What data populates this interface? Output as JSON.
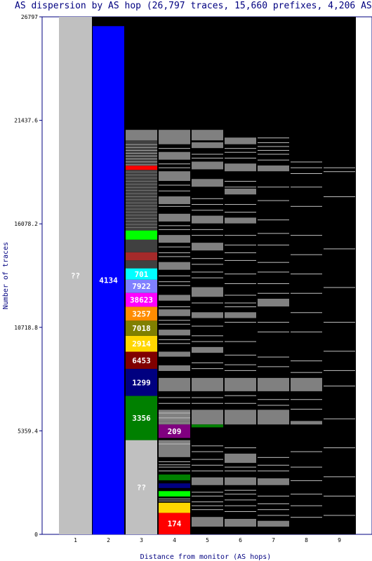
{
  "chart_data": {
    "type": "bar",
    "title": "AS dispersion by AS hop (26,797 traces, 15,660 prefixes, 4,206 ASes)",
    "xlabel": "Distance from monitor (AS hops)",
    "ylabel": "Number of traces",
    "ylim": [
      0,
      26797
    ],
    "y_ticks": [
      "0",
      "5359.4",
      "10718.8",
      "16078.2",
      "21437.6",
      "26797"
    ],
    "categories": [
      "1",
      "2",
      "3",
      "4",
      "5",
      "6",
      "7",
      "8",
      "9"
    ],
    "background_color": "#000000",
    "minor_segment_color": "#808080",
    "minor_line_color": "#c0c0c0",
    "labeled_segments": [
      {
        "hop": "1",
        "label": "??",
        "from": 0,
        "to": 26797,
        "color": "#c0c0c0"
      },
      {
        "hop": "2",
        "label": "4134",
        "from": 0,
        "to": 26315,
        "color": "#0000ff"
      },
      {
        "hop": "3",
        "label": "??",
        "from": 0,
        "to": 4880,
        "color": "#c0c0c0"
      },
      {
        "hop": "3",
        "label": "3356",
        "from": 4880,
        "to": 7169,
        "color": "#008000"
      },
      {
        "hop": "3",
        "label": "1299",
        "from": 7169,
        "to": 8568,
        "color": "#000080"
      },
      {
        "hop": "3",
        "label": "6453",
        "from": 8568,
        "to": 9458,
        "color": "#800000"
      },
      {
        "hop": "3",
        "label": "2914",
        "from": 9458,
        "to": 10281,
        "color": "#ffd700"
      },
      {
        "hop": "3",
        "label": "7018",
        "from": 10281,
        "to": 11065,
        "color": "#808000"
      },
      {
        "hop": "3",
        "label": "3257",
        "from": 11065,
        "to": 11785,
        "color": "#ff8c00"
      },
      {
        "hop": "3",
        "label": "38623",
        "from": 11785,
        "to": 12503,
        "color": "#ff00ff"
      },
      {
        "hop": "3",
        "label": "7922",
        "from": 12503,
        "to": 13189,
        "color": "#8080ff"
      },
      {
        "hop": "3",
        "label": "701",
        "from": 13189,
        "to": 13771,
        "color": "#00ffff"
      },
      {
        "hop": "4",
        "label": "209",
        "from": 4990,
        "to": 5688,
        "color": "#800080"
      },
      {
        "hop": "4",
        "label": "174",
        "from": 0,
        "to": 1110,
        "color": "#ff0000"
      }
    ],
    "unlabeled_segments": [
      {
        "hop": "3",
        "from": 13771,
        "to": 14189,
        "color": "#404040"
      },
      {
        "hop": "3",
        "from": 14189,
        "to": 14607,
        "color": "#a52a2a"
      },
      {
        "hop": "3",
        "from": 14607,
        "to": 15259,
        "color": "#404040"
      },
      {
        "hop": "3",
        "from": 15259,
        "to": 15736,
        "color": "#00ff00"
      },
      {
        "hop": "3",
        "from": 15736,
        "to": 18872,
        "color": "#404040"
      },
      {
        "hop": "3",
        "from": 18872,
        "to": 19090,
        "color": "#ff0000"
      },
      {
        "hop": "3",
        "from": 19090,
        "to": 20400,
        "color": "#404040"
      },
      {
        "hop": "3",
        "from": 20400,
        "to": 20945,
        "color": "#808080"
      },
      {
        "hop": "4",
        "from": 1110,
        "to": 1640,
        "color": "#ffd700"
      },
      {
        "hop": "4",
        "from": 1960,
        "to": 2240,
        "color": "#00ff00"
      },
      {
        "hop": "4",
        "from": 2400,
        "to": 2640,
        "color": "#000080"
      },
      {
        "hop": "4",
        "from": 2800,
        "to": 3100,
        "color": "#008000"
      },
      {
        "hop": "4",
        "from": 5688,
        "to": 5870,
        "color": "#808080"
      },
      {
        "hop": "5",
        "from": 5540,
        "to": 5690,
        "color": "#008000"
      }
    ],
    "gray_bands": [
      {
        "hop": "4",
        "ranges": [
          [
            4000,
            4880
          ],
          [
            5870,
            6450
          ],
          [
            7410,
            8100
          ],
          [
            8460,
            8750
          ],
          [
            9200,
            9460
          ],
          [
            10300,
            10600
          ],
          [
            11300,
            11650
          ],
          [
            12100,
            12400
          ],
          [
            13700,
            14100
          ],
          [
            15100,
            15500
          ],
          [
            16200,
            16600
          ],
          [
            17100,
            17500
          ],
          [
            18300,
            18800
          ],
          [
            19400,
            19800
          ],
          [
            20200,
            20945
          ]
        ]
      },
      {
        "hop": "5",
        "ranges": [
          [
            400,
            900
          ],
          [
            2550,
            2950
          ],
          [
            5690,
            6450
          ],
          [
            7410,
            8100
          ],
          [
            9400,
            9700
          ],
          [
            11200,
            11500
          ],
          [
            12300,
            12800
          ],
          [
            14700,
            15100
          ],
          [
            16100,
            16500
          ],
          [
            18000,
            18400
          ],
          [
            18900,
            19300
          ],
          [
            20000,
            20300
          ],
          [
            20400,
            20945
          ]
        ]
      },
      {
        "hop": "6",
        "ranges": [
          [
            400,
            800
          ],
          [
            2550,
            2950
          ],
          [
            3700,
            4180
          ],
          [
            5690,
            6450
          ],
          [
            7410,
            8100
          ],
          [
            11200,
            11500
          ],
          [
            16100,
            16400
          ],
          [
            17600,
            17900
          ],
          [
            18800,
            19200
          ],
          [
            20200,
            20545
          ]
        ]
      },
      {
        "hop": "7",
        "ranges": [
          [
            400,
            700
          ],
          [
            2550,
            2900
          ],
          [
            5690,
            6450
          ],
          [
            7410,
            8100
          ],
          [
            11800,
            12200
          ],
          [
            18800,
            19100
          ]
        ]
      },
      {
        "hop": "8",
        "ranges": [
          [
            5690,
            5870
          ],
          [
            7410,
            8100
          ]
        ]
      }
    ],
    "thin_lines": [
      {
        "hop": "4",
        "lines": [
          1750,
          1850,
          3300,
          3500,
          3620,
          3780,
          4700,
          6050,
          6300,
          6800,
          7100,
          9900,
          10100,
          10900,
          11100,
          11800,
          12900,
          13100,
          13400,
          14400,
          14600,
          14900,
          15800,
          16000,
          17000,
          17800,
          18100,
          19000,
          19200,
          20000
        ]
      },
      {
        "hop": "5",
        "lines": [
          1300,
          1500,
          1700,
          2000,
          2200,
          3300,
          3600,
          3900,
          4300,
          4600,
          6800,
          7100,
          8600,
          8900,
          10000,
          10300,
          10800,
          12000,
          13300,
          13600,
          14000,
          14300,
          15500,
          15800,
          16800,
          17100,
          17400,
          19500,
          19700
        ]
      },
      {
        "hop": "6",
        "lines": [
          1200,
          1500,
          1800,
          2100,
          2300,
          3300,
          3500,
          4500,
          6800,
          7200,
          8500,
          8800,
          9300,
          10000,
          11000,
          11800,
          12000,
          12400,
          13000,
          13500,
          14200,
          14600,
          15000,
          15500,
          16700,
          17100,
          18000,
          18300,
          19500,
          19800,
          20000
        ]
      },
      {
        "hop": "7",
        "lines": [
          1000,
          1300,
          1600,
          2000,
          3300,
          3600,
          4000,
          6700,
          7000,
          8700,
          9200,
          10500,
          11000,
          12500,
          13000,
          13600,
          14100,
          15000,
          15600,
          16300,
          17300,
          18000,
          19400,
          19700,
          19900,
          20100,
          20300,
          20545
        ]
      },
      {
        "hop": "8",
        "lines": [
          900,
          1500,
          2100,
          2800,
          3500,
          4300,
          6500,
          7000,
          8400,
          9000,
          10500,
          11500,
          12500,
          13500,
          14500,
          15500,
          17000,
          18000,
          18700,
          19000,
          19300
        ]
      },
      {
        "hop": "9",
        "lines": [
          1000,
          2000,
          3000,
          4500,
          6000,
          7700,
          8500,
          9500,
          11000,
          12800,
          14800,
          17500,
          18800,
          19000
        ]
      }
    ]
  }
}
